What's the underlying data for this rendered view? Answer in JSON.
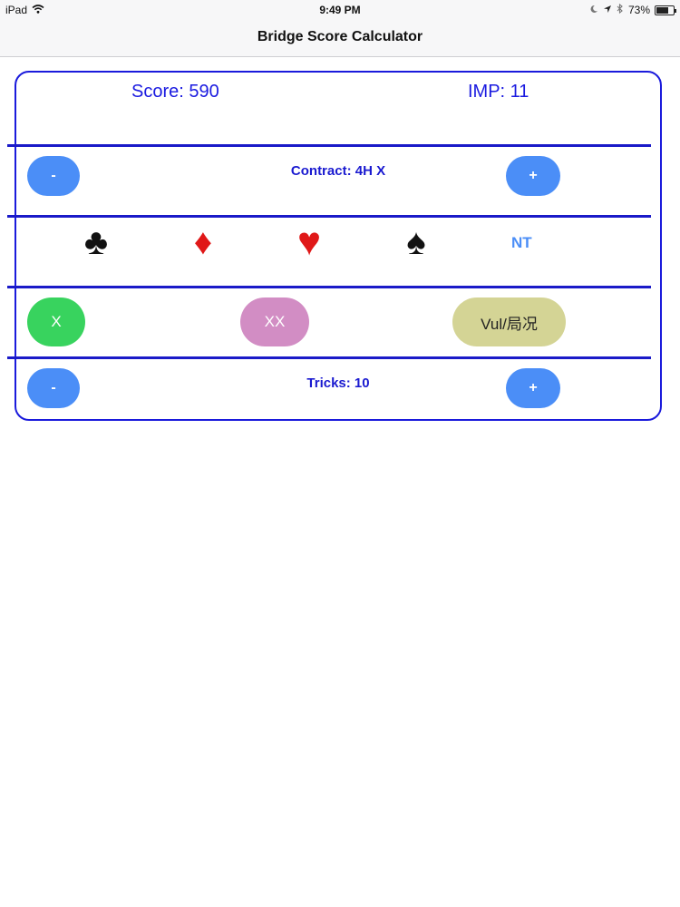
{
  "status_bar": {
    "device": "iPad",
    "time": "9:49 PM",
    "battery_text": "73%",
    "battery_level": 0.73,
    "icons": [
      "wifi-icon",
      "moon-icon",
      "location-arrow-icon",
      "bluetooth-icon",
      "battery-icon"
    ]
  },
  "nav": {
    "title": "Bridge Score Calculator"
  },
  "result": {
    "score": "Score: 590",
    "imp": "IMP: 11"
  },
  "contract": {
    "minus": "-",
    "label": "Contract: 4H X",
    "plus": "+"
  },
  "suits": {
    "clubs": "♣",
    "diamonds": "♦",
    "hearts": "♥",
    "spades": "♠",
    "nt": "NT"
  },
  "modifiers": {
    "double": "X",
    "redouble": "XX",
    "vul": "Vul/局况"
  },
  "tricks": {
    "minus": "-",
    "label": "Tricks: 10",
    "plus": "+"
  },
  "colors": {
    "accent_blue": "#1a1ae0",
    "button_blue": "#4b8ef7",
    "double_green": "#38d35e",
    "redouble_pink": "#d28dc4",
    "vul_olive": "#d4d495"
  }
}
